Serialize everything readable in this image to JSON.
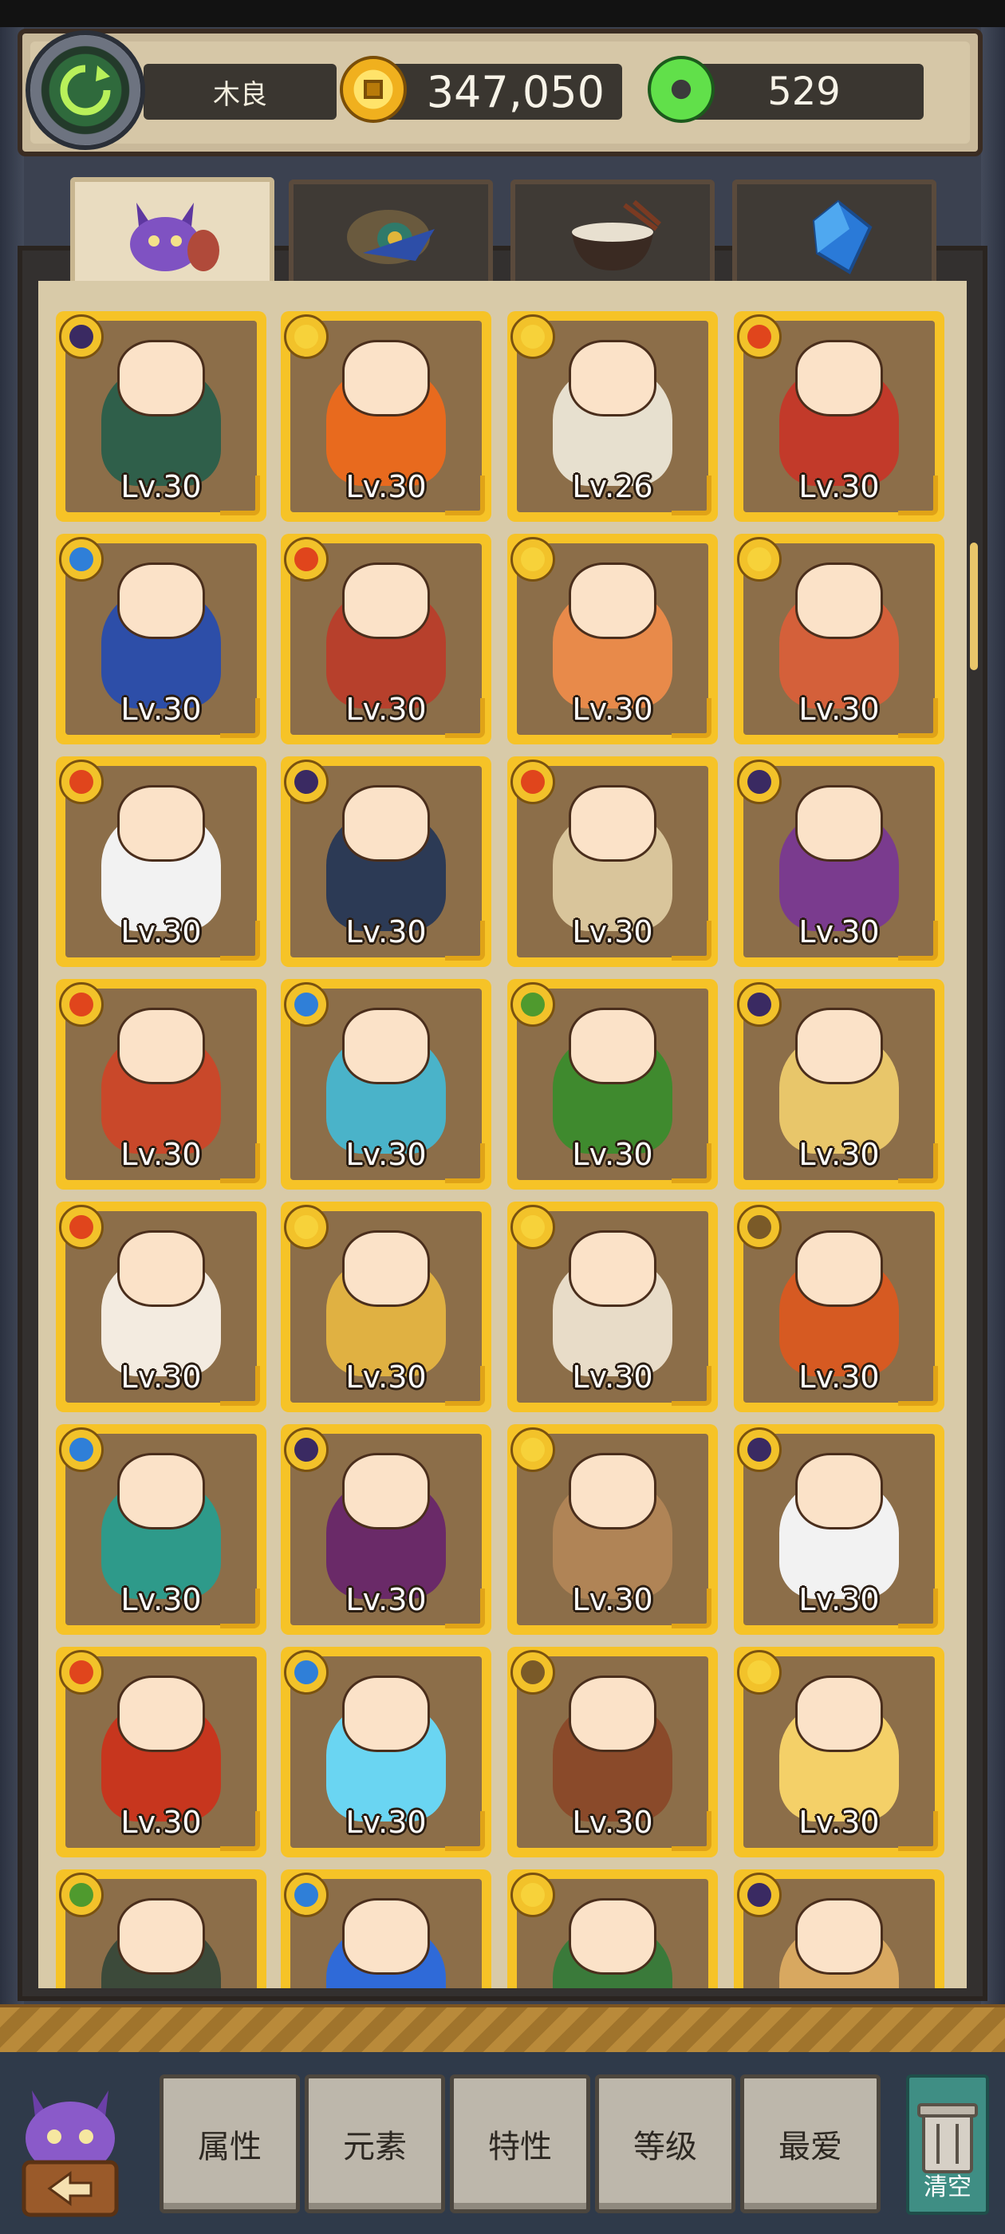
{
  "header": {
    "player_name": "木良",
    "coins": "347,050",
    "gems": "529"
  },
  "tabs": [
    {
      "name": "tab-characters",
      "icon": "purple-monster-icon",
      "active": true
    },
    {
      "name": "tab-items",
      "icon": "mask-feather-icon",
      "active": false
    },
    {
      "name": "tab-food",
      "icon": "noodle-bowl-icon",
      "active": false
    },
    {
      "name": "tab-crystals",
      "icon": "blue-crystal-icon",
      "active": false
    }
  ],
  "elements": {
    "moon": "#3a2a62",
    "sun": "#f7d23a",
    "fire": "#e0451c",
    "water": "#2f7fd8",
    "leaf": "#4f9a2e",
    "earth": "#7a5a28"
  },
  "characters": [
    {
      "level": "Lv.30",
      "element": "moon",
      "tone": "#2f5f4a"
    },
    {
      "level": "Lv.30",
      "element": "sun",
      "tone": "#e86a1e"
    },
    {
      "level": "Lv.26",
      "element": "sun",
      "tone": "#e7e0cf"
    },
    {
      "level": "Lv.30",
      "element": "fire",
      "tone": "#c23a2a"
    },
    {
      "level": "Lv.30",
      "element": "water",
      "tone": "#2d4ea8"
    },
    {
      "level": "Lv.30",
      "element": "fire",
      "tone": "#b7402c"
    },
    {
      "level": "Lv.30",
      "element": "sun",
      "tone": "#e88a4a"
    },
    {
      "level": "Lv.30",
      "element": "sun",
      "tone": "#d4603a"
    },
    {
      "level": "Lv.30",
      "element": "fire",
      "tone": "#f2f2f2"
    },
    {
      "level": "Lv.30",
      "element": "moon",
      "tone": "#2c3a55"
    },
    {
      "level": "Lv.30",
      "element": "fire",
      "tone": "#d9c59b"
    },
    {
      "level": "Lv.30",
      "element": "moon",
      "tone": "#7a3b8e"
    },
    {
      "level": "Lv.30",
      "element": "fire",
      "tone": "#c9482a"
    },
    {
      "level": "Lv.30",
      "element": "water",
      "tone": "#4ab3c9"
    },
    {
      "level": "Lv.30",
      "element": "leaf",
      "tone": "#3f8a2e"
    },
    {
      "level": "Lv.30",
      "element": "moon",
      "tone": "#e8c66a"
    },
    {
      "level": "Lv.30",
      "element": "fire",
      "tone": "#f3ebe0"
    },
    {
      "level": "Lv.30",
      "element": "sun",
      "tone": "#e0b142"
    },
    {
      "level": "Lv.30",
      "element": "sun",
      "tone": "#e8dcc8"
    },
    {
      "level": "Lv.30",
      "element": "earth",
      "tone": "#d65a22"
    },
    {
      "level": "Lv.30",
      "element": "water",
      "tone": "#2e9a8a"
    },
    {
      "level": "Lv.30",
      "element": "moon",
      "tone": "#6a2a68"
    },
    {
      "level": "Lv.30",
      "element": "sun",
      "tone": "#b08456"
    },
    {
      "level": "Lv.30",
      "element": "moon",
      "tone": "#f2f2f2"
    },
    {
      "level": "Lv.30",
      "element": "fire",
      "tone": "#c7361e"
    },
    {
      "level": "Lv.30",
      "element": "water",
      "tone": "#6ad5f2"
    },
    {
      "level": "Lv.30",
      "element": "earth",
      "tone": "#8a4a2a"
    },
    {
      "level": "Lv.30",
      "element": "sun",
      "tone": "#f4d068"
    },
    {
      "level": "",
      "element": "leaf",
      "tone": "#3c4a3a"
    },
    {
      "level": "",
      "element": "water",
      "tone": "#2f6ad8"
    },
    {
      "level": "",
      "element": "sun",
      "tone": "#3a7a3a"
    },
    {
      "level": "",
      "element": "moon",
      "tone": "#d8a860"
    }
  ],
  "filters": [
    "属性",
    "元素",
    "特性",
    "等级",
    "最爱"
  ],
  "clear_label": "清空"
}
